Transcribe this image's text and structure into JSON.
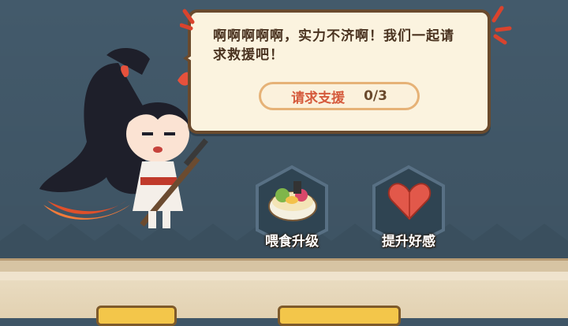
{
  "dialog": {
    "message": "啊啊啊啊啊，实力不济啊！我们一起请求救援吧！",
    "help_button_label": "请求支援",
    "help_progress": "0/3"
  },
  "actions": [
    {
      "label": "喂食升级",
      "icon": "food-bowl-icon"
    },
    {
      "label": "提升好感",
      "icon": "heart-icon"
    }
  ],
  "colors": {
    "background": "#435a6b",
    "bubble": "#fbf3df",
    "accent": "#d55a3c",
    "floor": "#efe3cd"
  }
}
